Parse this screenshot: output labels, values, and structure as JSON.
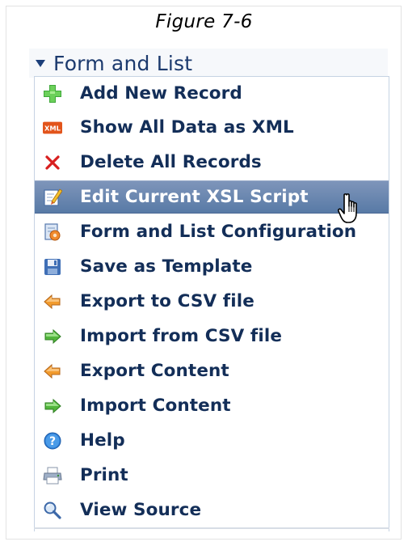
{
  "caption": "Figure 7-6",
  "menu": {
    "title": "Form and List",
    "items": [
      {
        "label": "Add New Record",
        "icon": "add-icon"
      },
      {
        "label": "Show All Data as XML",
        "icon": "xml-icon",
        "icon_text": "XML"
      },
      {
        "label": "Delete All Records",
        "icon": "delete-icon"
      },
      {
        "label": "Edit Current XSL Script",
        "icon": "edit-icon",
        "active": true
      },
      {
        "label": "Form and List Configuration",
        "icon": "configuration-icon"
      },
      {
        "label": "Save as Template",
        "icon": "save-icon"
      },
      {
        "label": "Export to CSV file",
        "icon": "export-arrow-icon"
      },
      {
        "label": "Import from CSV file",
        "icon": "import-arrow-icon"
      },
      {
        "label": "Export Content",
        "icon": "export-arrow-icon"
      },
      {
        "label": "Import Content",
        "icon": "import-arrow-icon"
      },
      {
        "label": "Help",
        "icon": "help-icon"
      },
      {
        "label": "Print",
        "icon": "print-icon"
      },
      {
        "label": "View Source",
        "icon": "magnifier-icon"
      }
    ]
  },
  "colors": {
    "header_text": "#1c3a6e",
    "item_text": "#132e58",
    "active_background": "#6a86b0",
    "active_text": "#ffffff"
  }
}
